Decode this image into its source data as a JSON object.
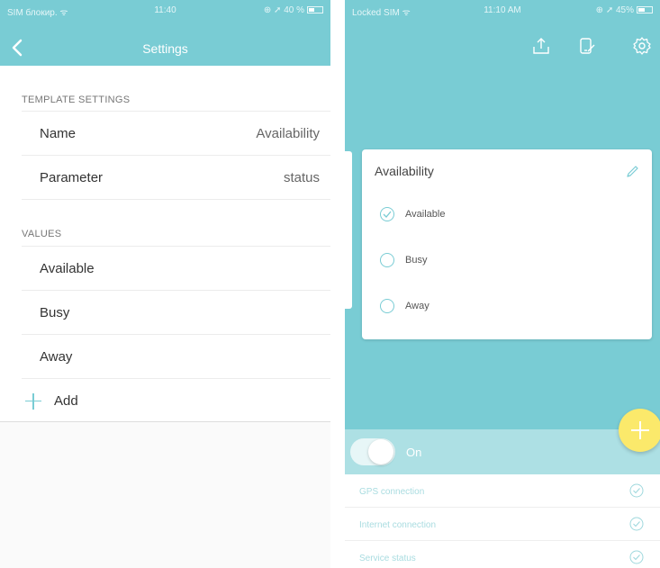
{
  "left": {
    "status_bar": {
      "carrier": "SIM блокир. ᯤ",
      "time": "11:40",
      "battery": "⊕ ➚ 40 %"
    },
    "nav": {
      "title": "Settings"
    },
    "template_section": {
      "header": "TEMPLATE SETTINGS"
    },
    "name_row": {
      "label": "Name",
      "value": "Availability"
    },
    "parameter_row": {
      "label": "Parameter",
      "value": "status"
    },
    "values_section": {
      "header": "VALUES"
    },
    "values": [
      "Available",
      "Busy",
      "Away"
    ],
    "add_label": "Add"
  },
  "right": {
    "status_bar": {
      "carrier": "Locked SIM ᯤ",
      "time": "11:10 AM",
      "battery": "⊕ ➚ 45%"
    },
    "icons": [
      "upload-icon",
      "phone-edit-icon",
      "gear-icon"
    ],
    "card": {
      "title": "Availability",
      "options": [
        {
          "label": "Available",
          "checked": true
        },
        {
          "label": "Busy",
          "checked": false
        },
        {
          "label": "Away",
          "checked": false
        }
      ]
    },
    "toggle": {
      "label": "On",
      "on": true
    },
    "status_items": [
      "GPS connection",
      "Internet connection",
      "Service status"
    ]
  },
  "colors": {
    "accent": "#79ccd4",
    "fab": "#fbe96b",
    "toggle_bar": "#ade0e4"
  }
}
